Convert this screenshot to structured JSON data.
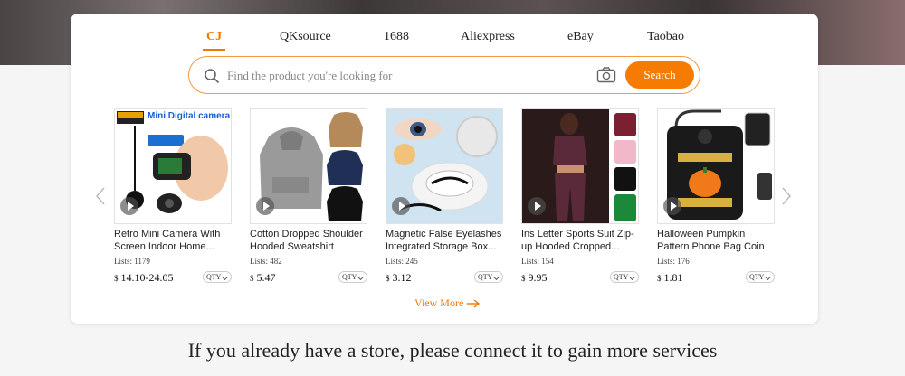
{
  "tabs": [
    {
      "label": "CJ",
      "active": true
    },
    {
      "label": "QKsource",
      "active": false
    },
    {
      "label": "1688",
      "active": false
    },
    {
      "label": "Aliexpress",
      "active": false
    },
    {
      "label": "eBay",
      "active": false
    },
    {
      "label": "Taobao",
      "active": false
    }
  ],
  "search": {
    "placeholder": "Find the product you're looking for",
    "button_label": "Search"
  },
  "products": [
    {
      "title": "Retro Mini Camera With Screen Indoor Home...",
      "lists": "Lists: 1179",
      "currency": "$",
      "price": "14.10-24.05",
      "qty": "QTY",
      "thumb_text": "Mini Digital camera"
    },
    {
      "title": "Cotton Dropped Shoulder Hooded Sweatshirt Men's...",
      "lists": "Lists: 482",
      "currency": "$",
      "price": "5.47",
      "qty": "QTY"
    },
    {
      "title": "Magnetic False Eyelashes Integrated Storage Box...",
      "lists": "Lists: 245",
      "currency": "$",
      "price": "3.12",
      "qty": "QTY"
    },
    {
      "title": "Ins Letter Sports Suit Zip-up Hooded Cropped...",
      "lists": "Lists: 154",
      "currency": "$",
      "price": "9.95",
      "qty": "QTY"
    },
    {
      "title": "Halloween Pumpkin Pattern Phone Bag Coin Wallet Cu...",
      "lists": "Lists: 176",
      "currency": "$",
      "price": "1.81",
      "qty": "QTY"
    }
  ],
  "view_more": "View More",
  "bottom_text": "If you already have a store, please connect it to gain more services",
  "colors": {
    "accent": "#f57c00",
    "search_border": "#f39a3e"
  }
}
